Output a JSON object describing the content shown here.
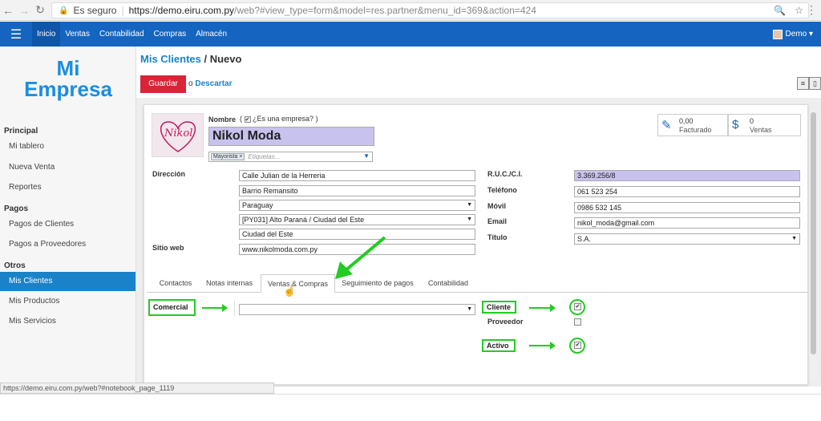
{
  "browser": {
    "secure_label": "Es seguro",
    "url_host": "https://demo.eiru.com.py",
    "url_rest": "/web?#view_type=form&model=res.partner&menu_id=369&action=424",
    "status_url": "https://demo.eiru.com.py/web?#notebook_page_1119"
  },
  "topnav": {
    "items": [
      "Inicio",
      "Ventas",
      "Contabilidad",
      "Compras",
      "Almacén"
    ],
    "user": "Demo"
  },
  "sidebar": {
    "logo_line1": "Mi",
    "logo_line2": "Empresa",
    "sections": [
      {
        "title": "Principal",
        "items": [
          "Mi tablero",
          "Nueva Venta",
          "Reportes"
        ]
      },
      {
        "title": "Pagos",
        "items": [
          "Pagos de Clientes",
          "Pagos a Proveedores"
        ]
      },
      {
        "title": "Otros",
        "items": [
          "Mis Clientes",
          "Mis Productos",
          "Mis Servicios"
        ]
      }
    ],
    "active_item": "Mis Clientes"
  },
  "breadcrumb": {
    "parent": "Mis Clientes",
    "current": "Nuevo"
  },
  "actions": {
    "save": "Guardar",
    "or": "o",
    "discard": "Descartar"
  },
  "form": {
    "avatar_text": "Nikol",
    "name_label": "Nombre",
    "is_company_label": "¿Es una empresa?",
    "name": "Nikol Moda",
    "tag": "Mayorista",
    "tag_placeholder": "Etiquetas...",
    "stats": [
      {
        "value": "0,00",
        "label": "Facturado"
      },
      {
        "value": "0",
        "label": "Ventas"
      }
    ],
    "address_label": "Dirección",
    "street": "Calle Julian de la Herreria",
    "street2": "Barrio Remansito",
    "country": "Paraguay",
    "state": "[PY031] Alto Paraná / Ciudad del Este",
    "city": "Ciudad del Este",
    "website_label": "Sitio web",
    "website": "www.nikolmoda.com.py",
    "ruc_label": "R.U.C./C.I.",
    "ruc": "3.369.256/8",
    "phone_label": "Teléfono",
    "phone": "061 523 254",
    "mobile_label": "Móvil",
    "mobile": "0986 532 145",
    "email_label": "Email",
    "email": "nikol_moda@gmail.com",
    "title_label": "Título",
    "title": "S.A."
  },
  "tabs": [
    "Contactos",
    "Notas internas",
    "Ventas & Compras",
    "Seguimiento de pagos",
    "Contabilidad"
  ],
  "active_tab": "Ventas & Compras",
  "sales_tab": {
    "salesperson_label": "Comercial",
    "customer_label": "Cliente",
    "customer_checked": true,
    "supplier_label": "Proveedor",
    "supplier_checked": false,
    "active_label": "Activo",
    "active_checked": true
  },
  "colors": {
    "nav": "#1565c0",
    "accent": "#1a82c8",
    "save": "#d92438",
    "highlight": "#22cc22"
  }
}
